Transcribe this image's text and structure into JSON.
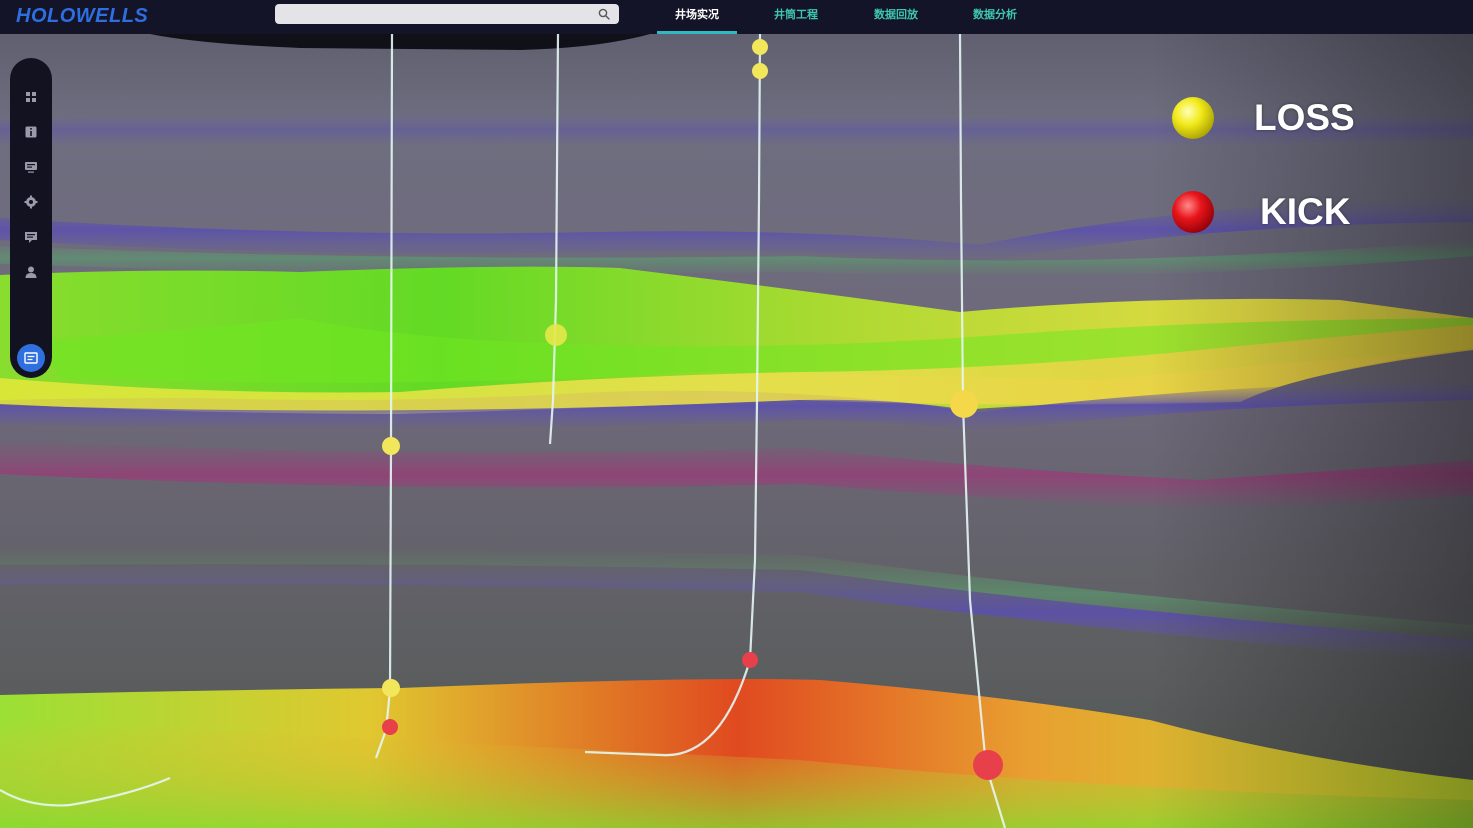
{
  "header": {
    "logo": "HOLOWELLS",
    "search": {
      "value": "",
      "placeholder": ""
    },
    "tabs": [
      {
        "label": "井场实况",
        "active": true
      },
      {
        "label": "井筒工程",
        "active": false
      },
      {
        "label": "数据回放",
        "active": false
      },
      {
        "label": "数据分析",
        "active": false
      }
    ]
  },
  "sidebar": {
    "items": [
      {
        "icon": "dashboard-icon"
      },
      {
        "icon": "info-icon"
      },
      {
        "icon": "monitor-icon"
      },
      {
        "icon": "settings-icon"
      },
      {
        "icon": "message-icon"
      },
      {
        "icon": "user-icon"
      },
      {
        "icon": "list-icon",
        "active": true
      }
    ]
  },
  "legend": {
    "items": [
      {
        "label": "LOSS",
        "color": "#f2ea1a"
      },
      {
        "label": "KICK",
        "color": "#e8151b"
      }
    ]
  },
  "colors": {
    "topbar": "#141428",
    "logo": "#2f6ee0",
    "tab_inactive": "#3ec7b0",
    "tab_underline": "#2fb9c0",
    "loss_marker": "#f2e65a",
    "kick_marker": "#e8404a"
  }
}
